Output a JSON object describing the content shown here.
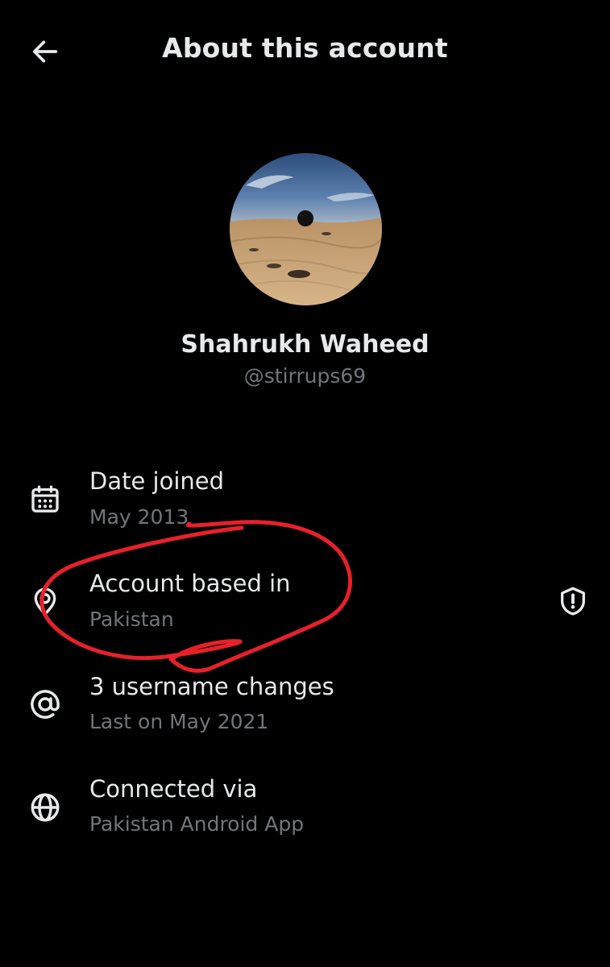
{
  "header": {
    "title": "About this account",
    "back_icon": "arrow-left-icon"
  },
  "profile": {
    "name": "Shahrukh Waheed",
    "handle": "@stirrups69"
  },
  "rows": [
    {
      "icon": "calendar-icon",
      "title": "Date joined",
      "subtitle": "May 2013"
    },
    {
      "icon": "location-pin-icon",
      "title": "Account based in",
      "subtitle": "Pakistan"
    },
    {
      "icon": "at-sign-icon",
      "title": "3 username changes",
      "subtitle": "Last on May 2021"
    },
    {
      "icon": "globe-icon",
      "title": "Connected via",
      "subtitle": "Pakistan Android App"
    }
  ],
  "colors": {
    "background": "#000000",
    "primary_text": "#e7e9ea",
    "secondary_text": "#71767b",
    "annotation": "#e8202a"
  },
  "accessories": {
    "shield_icon": "shield-alert-icon"
  }
}
